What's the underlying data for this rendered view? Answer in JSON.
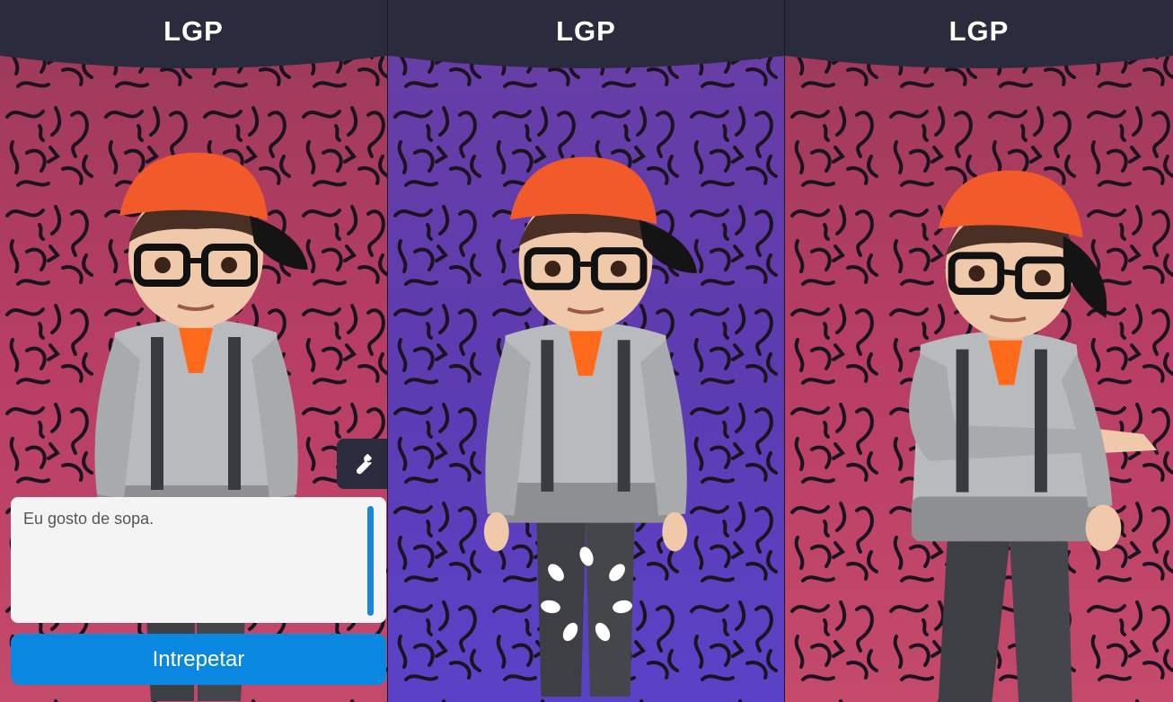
{
  "screens": [
    {
      "header_title": "LGP",
      "background": "red"
    },
    {
      "header_title": "LGP",
      "background": "purple"
    },
    {
      "header_title": "LGP",
      "background": "red"
    }
  ],
  "input": {
    "value": "Eu gosto de sopa."
  },
  "buttons": {
    "interpret_label": "Intrepetar",
    "settings_icon": "wrench-icon"
  },
  "colors": {
    "header": "#2a2b3d",
    "red_background": "#b83d64",
    "purple_background": "#5d3bb0",
    "button": "#0a87e0",
    "input_background": "#f4f4f4"
  }
}
